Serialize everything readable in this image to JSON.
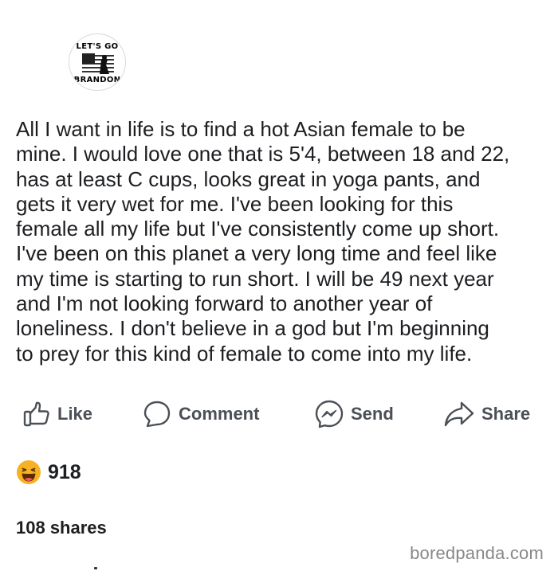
{
  "profile": {
    "avatar_text_top": "LET'S GO",
    "avatar_text_bottom": "BRANDON"
  },
  "post": {
    "text": "All I want in life is to find a hot Asian female to be\nmine. I would love one that is 5'4, between 18 and 22,\nhas at least C cups, looks great in yoga pants, and\ngets it very wet for me. I've been looking for this\nfemale all my life but I've consistently come up short.\nI've been on this planet a very long time and feel like\nmy time is starting to run short. I will be 49 next year\nand I'm not looking forward to another year of\nloneliness. I don't believe in a god but I'm beginning\nto prey for this kind of female to come into my life."
  },
  "actions": {
    "like": {
      "label": "Like",
      "icon": "thumbs-up-icon"
    },
    "comment": {
      "label": "Comment",
      "icon": "comment-bubble-icon"
    },
    "send": {
      "label": "Send",
      "icon": "messenger-icon"
    },
    "share": {
      "label": "Share",
      "icon": "share-arrow-icon"
    }
  },
  "reactions": {
    "emoji": "laughing-face-icon",
    "count": "918"
  },
  "shares": {
    "text": "108 shares"
  },
  "watermark": {
    "text": "boredpanda.com"
  },
  "colors": {
    "text": "#1c1e21",
    "action": "#4b4f56",
    "watermark": "#888888",
    "emoji": "#f7b125"
  }
}
